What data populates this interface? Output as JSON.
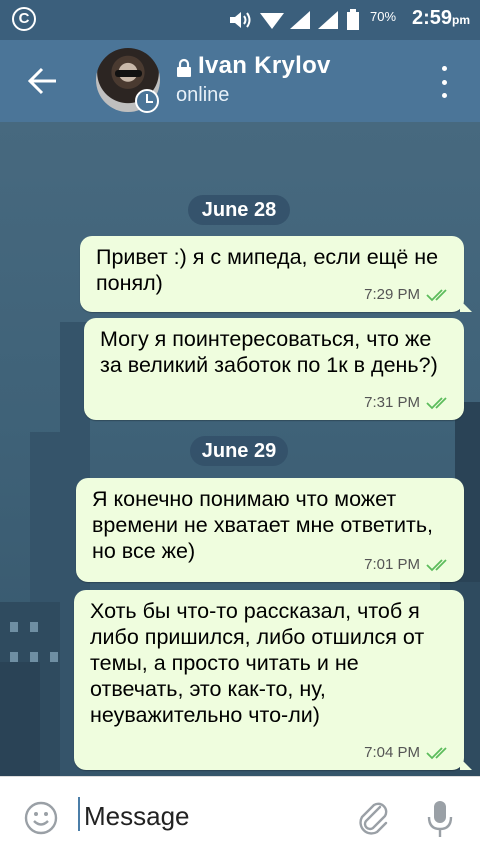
{
  "status_bar": {
    "carrier_icon": "circled-c-icon",
    "battery_percent": "70%",
    "time": "2:59",
    "ampm": "pm"
  },
  "header": {
    "contact_name": "Ivan Krylov",
    "status": "online"
  },
  "messages": [
    {
      "date_separator": "June 28"
    },
    {
      "text": "Привет :) я с мипеда, если ещё не понял)",
      "time": "7:29 PM",
      "read": true
    },
    {
      "text": "Могу я поинтересоваться, что же за великий заботок по 1к в день?)",
      "time": "7:31 PM",
      "read": true
    },
    {
      "date_separator": "June 29"
    },
    {
      "text": "Я конечно понимаю что может времени не хватает мне ответить, но все же)",
      "time": "7:01 PM",
      "read": true
    },
    {
      "text": "Хоть бы что-то рассказал, чтоб я либо пришился, либо отшился от темы, а просто читать и не отвечать, это как-то, ну, неуважительно что-ли)",
      "time": "7:04 PM",
      "read": true
    }
  ],
  "input": {
    "placeholder": "Message"
  },
  "colors": {
    "header_bg": "#4b7598",
    "bubble_bg": "#effdde",
    "read_check": "#5cbc5c"
  }
}
